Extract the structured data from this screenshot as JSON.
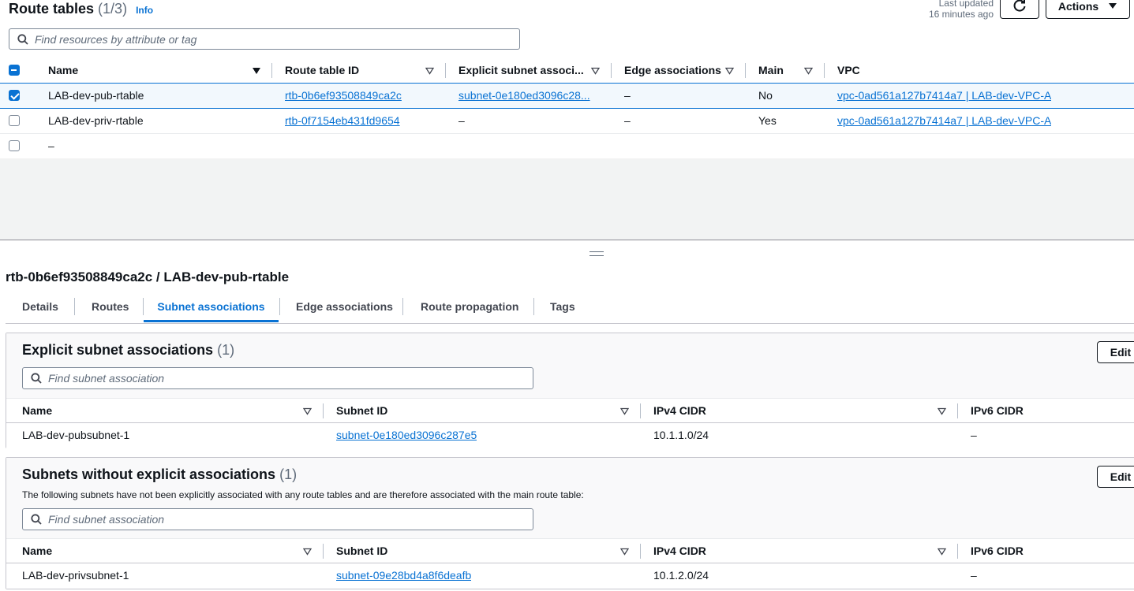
{
  "header": {
    "title": "Route tables",
    "count": "(1/3)",
    "info": "Info",
    "last_updated_label": "Last updated",
    "last_updated_value": "16 minutes ago",
    "actions_label": "Actions",
    "search_placeholder": "Find resources by attribute or tag"
  },
  "table": {
    "columns": [
      "Name",
      "Route table ID",
      "Explicit subnet associ...",
      "Edge associations",
      "Main",
      "VPC"
    ],
    "rows": [
      {
        "selected": true,
        "name": "LAB-dev-pub-rtable",
        "id": "rtb-0b6ef93508849ca2c",
        "subnet": "subnet-0e180ed3096c28...",
        "edge": "–",
        "main": "No",
        "vpc": "vpc-0ad561a127b7414a7 | LAB-dev-VPC-A"
      },
      {
        "selected": false,
        "name": "LAB-dev-priv-rtable",
        "id": "rtb-0f7154eb431fd9654",
        "subnet": "–",
        "edge": "–",
        "main": "Yes",
        "vpc": "vpc-0ad561a127b7414a7 | LAB-dev-VPC-A"
      },
      {
        "selected": false,
        "name": "–",
        "id": "",
        "subnet": "",
        "edge": "",
        "main": "",
        "vpc": ""
      }
    ]
  },
  "detail": {
    "title": "rtb-0b6ef93508849ca2c / LAB-dev-pub-rtable",
    "tabs": [
      "Details",
      "Routes",
      "Subnet associations",
      "Edge associations",
      "Route propagation",
      "Tags"
    ],
    "active_tab": "Subnet associations",
    "explicit": {
      "title": "Explicit subnet associations",
      "count": "(1)",
      "edit_label": "Edit",
      "search_placeholder": "Find subnet association",
      "columns": [
        "Name",
        "Subnet ID",
        "IPv4 CIDR",
        "IPv6 CIDR"
      ],
      "rows": [
        {
          "name": "LAB-dev-pubsubnet-1",
          "subnet_id": "subnet-0e180ed3096c287e5",
          "ipv4": "10.1.1.0/24",
          "ipv6": "–"
        }
      ]
    },
    "implicit": {
      "title": "Subnets without explicit associations",
      "count": "(1)",
      "edit_label": "Edit",
      "description": "The following subnets have not been explicitly associated with any route tables and are therefore associated with the main route table:",
      "search_placeholder": "Find subnet association",
      "columns": [
        "Name",
        "Subnet ID",
        "IPv4 CIDR",
        "IPv6 CIDR"
      ],
      "rows": [
        {
          "name": "LAB-dev-privsubnet-1",
          "subnet_id": "subnet-09e28bd4a8f6deafb",
          "ipv4": "10.1.2.0/24",
          "ipv6": "–"
        }
      ]
    }
  },
  "colors": {
    "link": "#0972d3",
    "text": "#0f141a",
    "muted": "#5f6b7a",
    "selected_row": "#f2f8fd"
  },
  "icons": [
    "search-icon",
    "refresh-icon",
    "caret-down-icon",
    "sort-icon",
    "drag-handle-icon"
  ]
}
